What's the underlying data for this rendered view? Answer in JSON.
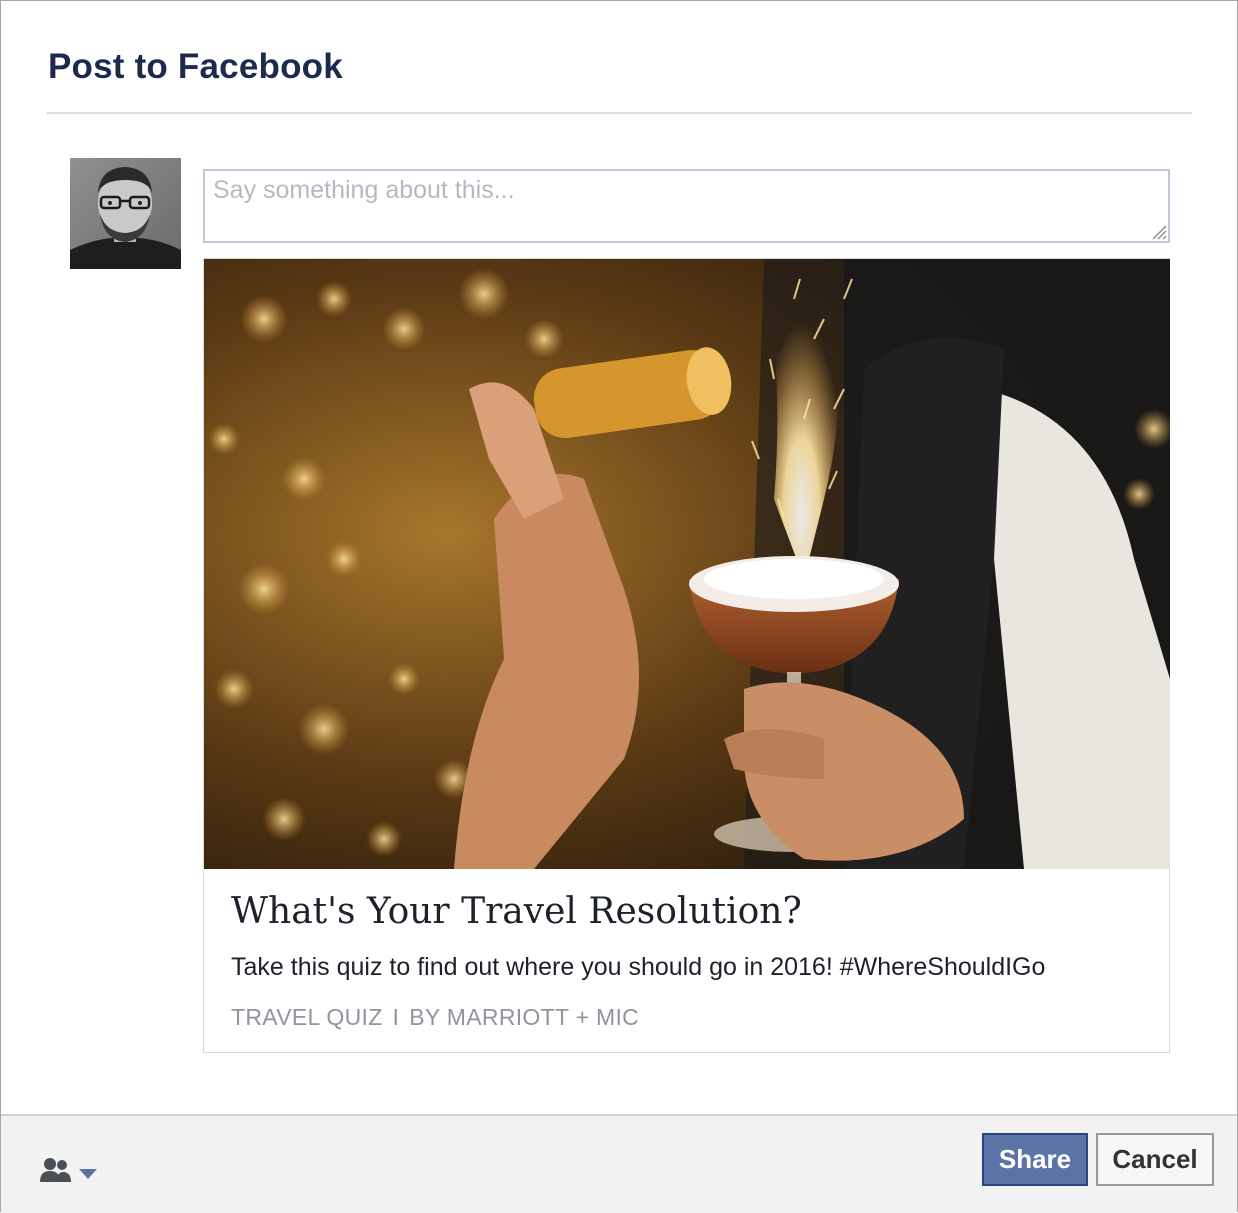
{
  "dialog": {
    "title": "Post to Facebook"
  },
  "composer": {
    "placeholder": "Say something about this..."
  },
  "card": {
    "title": "What's Your Travel Resolution?",
    "description": "Take this quiz to find out where you should go in 2016! #WhereShouldIGo",
    "category": "TRAVEL QUIZ",
    "separator": "I",
    "byline": "BY MARRIOTT + MIC"
  },
  "footer": {
    "audience_icon": "friends-icon",
    "share_label": "Share",
    "cancel_label": "Cancel"
  },
  "colors": {
    "title": "#1d2a4d",
    "share_bg": "#5b74a8",
    "share_border": "#29447e",
    "footer_bg": "#f2f2f2",
    "muted_text": "#90949c"
  }
}
